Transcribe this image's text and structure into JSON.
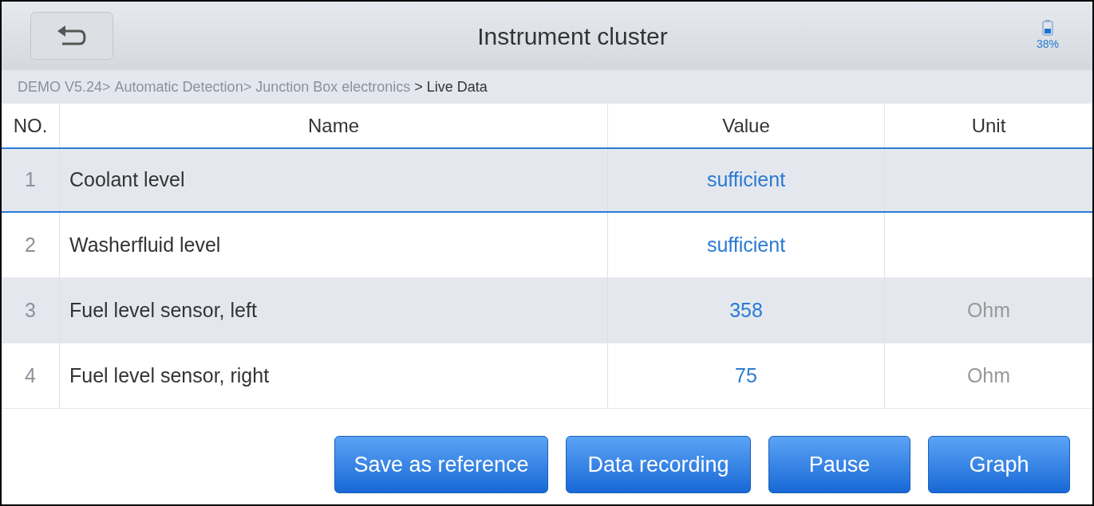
{
  "header": {
    "title": "Instrument cluster",
    "battery": "38%"
  },
  "breadcrumb": [
    {
      "label": "DEMO V5.24>",
      "current": false
    },
    {
      "label": "Automatic Detection>",
      "current": false
    },
    {
      "label": "Junction Box electronics",
      "current": false
    },
    {
      "label": "> Live Data",
      "current": true
    }
  ],
  "table": {
    "columns": [
      "NO.",
      "Name",
      "Value",
      "Unit"
    ],
    "rows": [
      {
        "no": "1",
        "name": "Coolant level",
        "value": "sufficient",
        "selected": true
      },
      {
        "no": "2",
        "name": "Washerfluid level",
        "value": "sufficient",
        "selected": false
      },
      {
        "no": "3",
        "name": "Fuel level sensor, left",
        "value": "358",
        "unit": "Ohm",
        "selected": false
      },
      {
        "no": "4",
        "name": "Fuel level sensor, right",
        "value": "75",
        "unit": "Ohm",
        "selected": false
      }
    ]
  },
  "buttons": [
    "Save as reference",
    "Data recording",
    "Pause",
    "Graph"
  ]
}
